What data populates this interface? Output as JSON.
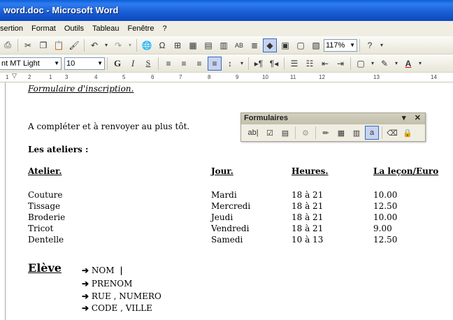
{
  "window": {
    "title": "word.doc - Microsoft Word"
  },
  "menu": [
    "sertion",
    "Format",
    "Outils",
    "Tableau",
    "Fenêtre",
    "?"
  ],
  "toolbar": {
    "zoom": "117%",
    "font_name": "nt MT Light",
    "font_size": "10"
  },
  "ruler_labels": [
    "1",
    "2",
    "1",
    "3",
    "4",
    "5",
    "6",
    "7",
    "8",
    "9",
    "10",
    "11",
    "12",
    "13",
    "14"
  ],
  "forms_toolbar": {
    "title": "Formulaires",
    "text_field_label": "ab|"
  },
  "document": {
    "heading": "Formulaire d'inscription.",
    "instruction": "A compléter et à renvoyer au plus tôt.",
    "ateliers_title": "Les ateliers :",
    "table": {
      "headers": [
        "Atelier.",
        "Jour.",
        "Heures.",
        "La leçon/Euro"
      ],
      "rows": [
        [
          "Couture",
          "Mardi",
          "18 à 21",
          "10.00"
        ],
        [
          "Tissage",
          "Mercredi",
          "18 à 21",
          "12.50"
        ],
        [
          "Broderie",
          "Jeudi",
          "18 à 21",
          "10.00"
        ],
        [
          "Tricot",
          "Vendredi",
          "18 à 21",
          "9.00"
        ],
        [
          "Dentelle",
          "Samedi",
          "10 à 13",
          "12.50"
        ]
      ]
    },
    "eleve": {
      "label": "Elève",
      "fields": [
        "NOM",
        "PRENOM",
        "RUE , NUMERO",
        "CODE , VILLE"
      ]
    }
  }
}
